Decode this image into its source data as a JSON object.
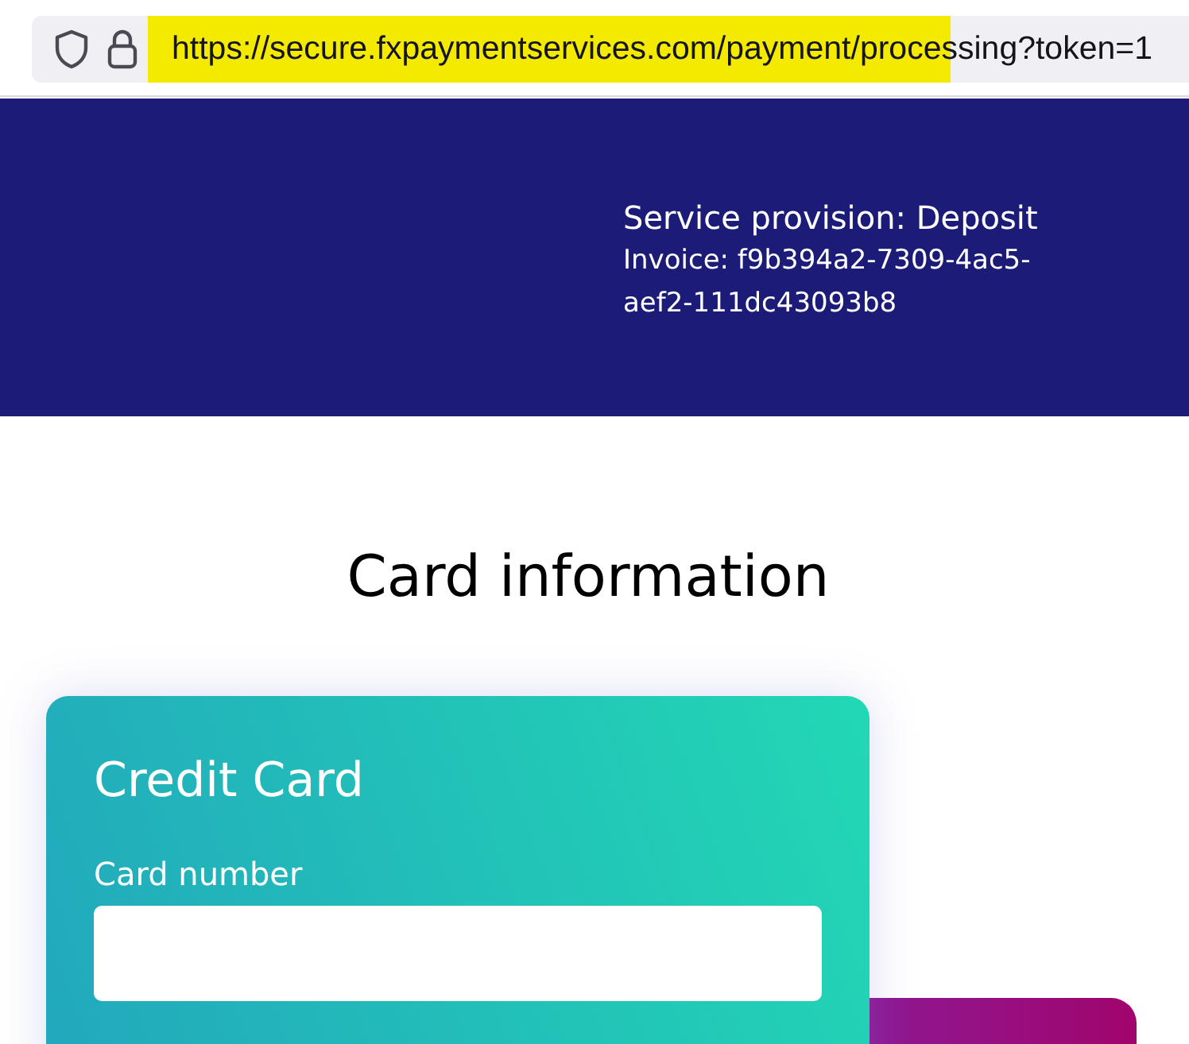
{
  "address_bar": {
    "url": "https://secure.fxpaymentservices.com/payment/processing?token=1"
  },
  "header": {
    "service": "Service provision: Deposit",
    "invoice": "Invoice: f9b394a2-7309-4ac5-aef2-111dc43093b8"
  },
  "page_title": "Card information",
  "card_form": {
    "title": "Credit Card",
    "fields": [
      {
        "label": "Card number"
      }
    ]
  }
}
